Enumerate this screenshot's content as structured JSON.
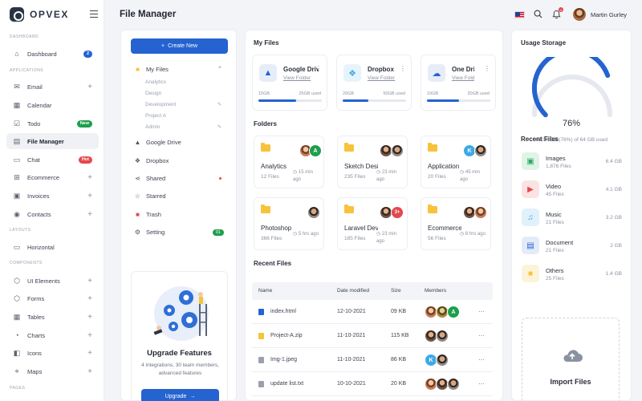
{
  "brand": {
    "name": "OPVEX"
  },
  "sidebar": {
    "sections": {
      "dashboard": "DASHBOARD",
      "applications": "APPLICATIONS",
      "layouts": "LAYOUTS",
      "components": "COMPONENTS",
      "pages": "PAGES"
    },
    "items": [
      {
        "label": "Dashboard",
        "badge": "2",
        "badge_color": "#2563d0"
      },
      {
        "label": "Email"
      },
      {
        "label": "Calendar"
      },
      {
        "label": "Todo",
        "badge": "New",
        "badge_color": "#1e9e4e"
      },
      {
        "label": "File Manager"
      },
      {
        "label": "Chat",
        "badge": "Hot",
        "badge_color": "#e5484d"
      },
      {
        "label": "Ecommerce"
      },
      {
        "label": "Invoices"
      },
      {
        "label": "Contacts"
      },
      {
        "label": "Horizontal"
      },
      {
        "label": "UI Elements"
      },
      {
        "label": "Forms"
      },
      {
        "label": "Tables"
      },
      {
        "label": "Charts"
      },
      {
        "label": "Icons"
      },
      {
        "label": "Maps"
      }
    ]
  },
  "header": {
    "title": "File Manager",
    "user_name": "Martin Gurley",
    "notification_count": "4"
  },
  "fm_nav": {
    "create_label": "Create New",
    "my_files": "My Files",
    "sub_items": [
      "Analytics",
      "Design",
      "Development",
      "Project A",
      "Admin"
    ],
    "items": [
      "Google Drive",
      "Dropbox",
      "Shared",
      "Starred",
      "Trash",
      "Setting"
    ],
    "setting_badge": "01",
    "upgrade": {
      "title": "Upgrade Features",
      "text": "4 integrations, 30 team members, advanced features",
      "button": "Upgrade"
    }
  },
  "my_files": {
    "title": "My Files",
    "storages": [
      {
        "name": "Google Drive",
        "link": "View Folder",
        "used": "15GB",
        "total": "25GB used",
        "fraction": 0.6,
        "icon": "google-drive-icon",
        "icon_color": "#2563d0",
        "bg": "#e7edf8"
      },
      {
        "name": "Dropbox",
        "link": "View Folder",
        "used": "20GB",
        "total": "50GB used",
        "fraction": 0.4,
        "icon": "dropbox-icon",
        "icon_color": "#3fa9e6",
        "bg": "#e7f3fb"
      },
      {
        "name": "One Drive",
        "link": "View Folder",
        "used": "10GB",
        "total": "20GB used",
        "fraction": 0.5,
        "icon": "cloud-icon",
        "icon_color": "#2563d0",
        "bg": "#e7edf8"
      }
    ]
  },
  "folders": {
    "title": "Folders",
    "items": [
      {
        "name": "Analytics",
        "count": "12 Files",
        "time": "15 min ago"
      },
      {
        "name": "Sketch Design",
        "count": "235 Files",
        "time": "23 min ago"
      },
      {
        "name": "Application",
        "count": "20 Files",
        "time": "45 min ago"
      },
      {
        "name": "Photoshop",
        "count": "366 Files",
        "time": "5 hrs ago"
      },
      {
        "name": "Laravel Dev",
        "count": "185 Files",
        "time": "23 min ago"
      },
      {
        "name": "Ecommerce",
        "count": "56 Files",
        "time": "8 hrs ago"
      }
    ]
  },
  "recent_table": {
    "title": "Recent Files",
    "columns": [
      "Name",
      "Date modified",
      "Size",
      "Members"
    ],
    "rows": [
      {
        "name": "index.html",
        "date": "12-10-2021",
        "size": "09 KB"
      },
      {
        "name": "Project-A.zip",
        "date": "11-10-2021",
        "size": "115 KB"
      },
      {
        "name": "Img-1.jpeg",
        "date": "11-10-2021",
        "size": "86 KB"
      },
      {
        "name": "update list.txt",
        "date": "10-10-2021",
        "size": "20 KB"
      }
    ]
  },
  "usage": {
    "title": "Usage Storage",
    "percent": "76%",
    "percent_value": 76,
    "subtitle": "48.02 GB (76%) of 64 GB used"
  },
  "recent_files": {
    "title": "Recent Files",
    "items": [
      {
        "name": "Images",
        "count": "1,876 Files",
        "size": "6.4 GB",
        "icon": "image-icon",
        "color": "#2fa866",
        "bg": "#dff3e7"
      },
      {
        "name": "Video",
        "count": "45 Files",
        "size": "4.1 GB",
        "icon": "play-icon",
        "color": "#e5484d",
        "bg": "#fbe3e4"
      },
      {
        "name": "Music",
        "count": "21 Files",
        "size": "3.2 GB",
        "icon": "music-icon",
        "color": "#3fa9e6",
        "bg": "#e1f1fb"
      },
      {
        "name": "Document",
        "count": "21 Files",
        "size": "2 GB",
        "icon": "document-icon",
        "color": "#2563d0",
        "bg": "#e3ebf9"
      },
      {
        "name": "Others",
        "count": "25 Files",
        "size": "1.4 GB",
        "icon": "folder-icon",
        "color": "#f6c33b",
        "bg": "#fdf3d9"
      }
    ],
    "import_label": "Import Files"
  },
  "colors": {
    "accent": "#2563d0",
    "folder": "#f6c33b"
  }
}
